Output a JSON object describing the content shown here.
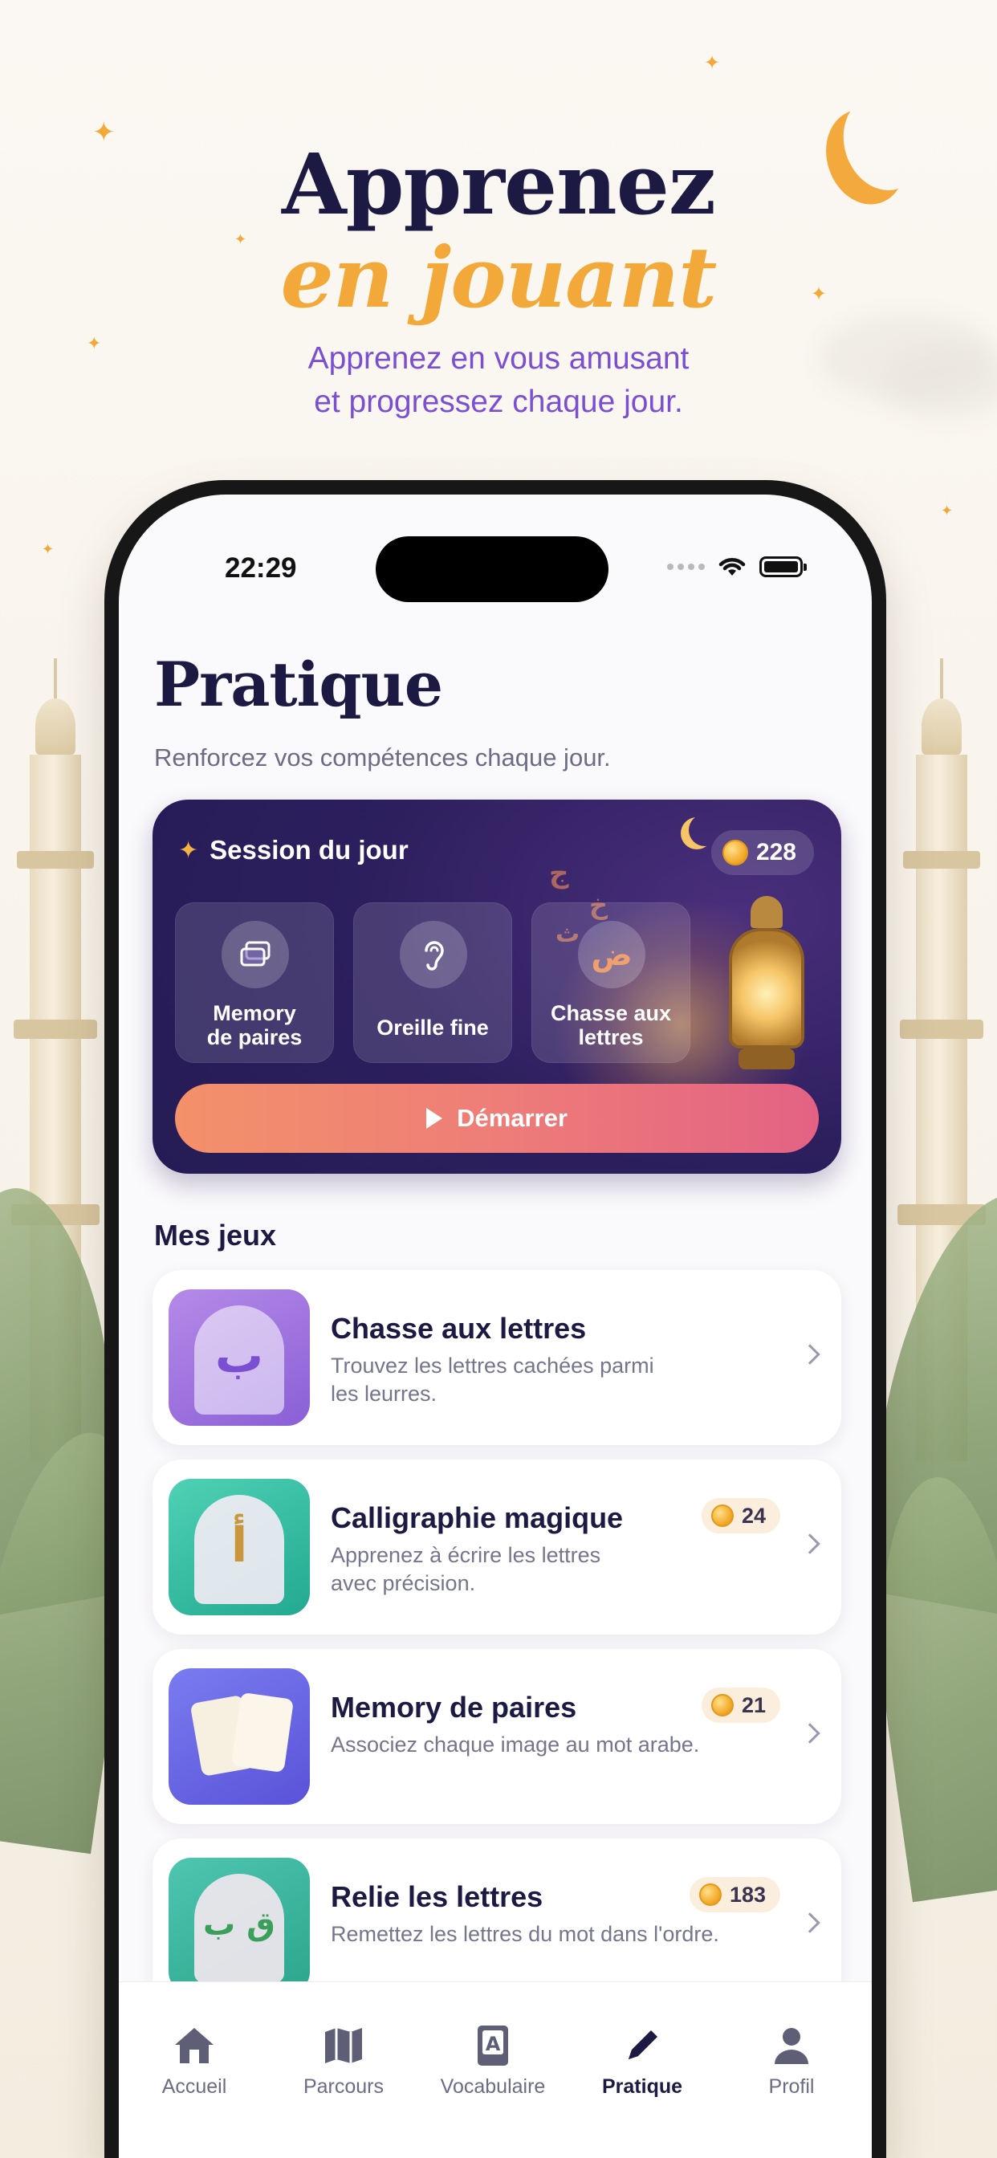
{
  "hero": {
    "line1": "Apprenez",
    "line2": "en jouant",
    "subtitle_line1": "Apprenez en vous amusant",
    "subtitle_line2": "et progressez chaque jour."
  },
  "status_bar": {
    "time": "22:29"
  },
  "page": {
    "title": "Pratique",
    "subtitle": "Renforcez vos compétences chaque jour."
  },
  "session": {
    "title": "Session du jour",
    "coins": "228",
    "activities": [
      {
        "label_line1": "Memory",
        "label_line2": "de paires",
        "icon": "cards-icon"
      },
      {
        "label_line1": "Oreille fine",
        "label_line2": "",
        "icon": "ear-icon"
      },
      {
        "label_line1": "Chasse aux",
        "label_line2": "lettres",
        "icon": "arabic-letter-icon"
      }
    ],
    "start_label": "Démarrer"
  },
  "games_section": {
    "title": "Mes jeux"
  },
  "games": [
    {
      "name": "Chasse aux lettres",
      "desc_line1": "Trouvez les lettres cachées parmi",
      "desc_line2": "les leurres.",
      "coins": ""
    },
    {
      "name": "Calligraphie magique",
      "desc_line1": "Apprenez à écrire les lettres",
      "desc_line2": "avec précision.",
      "coins": "24"
    },
    {
      "name": "Memory de paires",
      "desc_line1": "Associez chaque image au mot arabe.",
      "desc_line2": "",
      "coins": "21"
    },
    {
      "name": "Relie les lettres",
      "desc_line1": "Remettez les lettres du mot dans l'ordre.",
      "desc_line2": "",
      "coins": "183"
    }
  ],
  "tabbar": {
    "items": [
      {
        "label": "Accueil",
        "icon": "home-icon"
      },
      {
        "label": "Parcours",
        "icon": "map-icon"
      },
      {
        "label": "Vocabulaire",
        "icon": "book-icon"
      },
      {
        "label": "Pratique",
        "icon": "pencil-icon",
        "active": true
      },
      {
        "label": "Profil",
        "icon": "person-icon"
      }
    ]
  },
  "colors": {
    "navy": "#1c1a43",
    "gold": "#f3a93a",
    "purple": "#7b4fd1",
    "session_bg": "#2d1f5e",
    "start_gradient_from": "#f3916a",
    "start_gradient_to": "#e36284"
  }
}
